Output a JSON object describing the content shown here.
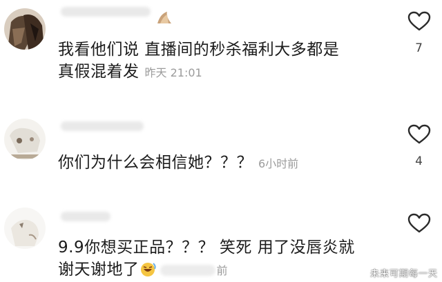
{
  "comments": [
    {
      "text_line1": "我看他们说 直播间的秒杀福利大多都是",
      "text_line2": "真假混着发",
      "time": "昨天 21:01",
      "likes": "7"
    },
    {
      "text_line1": "你们为什么会相信她？？？",
      "time": "6小时前",
      "likes": "4"
    },
    {
      "text_line1": "9.9你想买正品？？？ 笑死 用了没唇炎就",
      "text_line2": "谢天谢地了",
      "time_partial": "前",
      "likes": ""
    }
  ],
  "watermark": "未来可期每一天",
  "icons": {
    "like": "heart-outline-icon",
    "emoji": "laughing-emoji-icon"
  }
}
